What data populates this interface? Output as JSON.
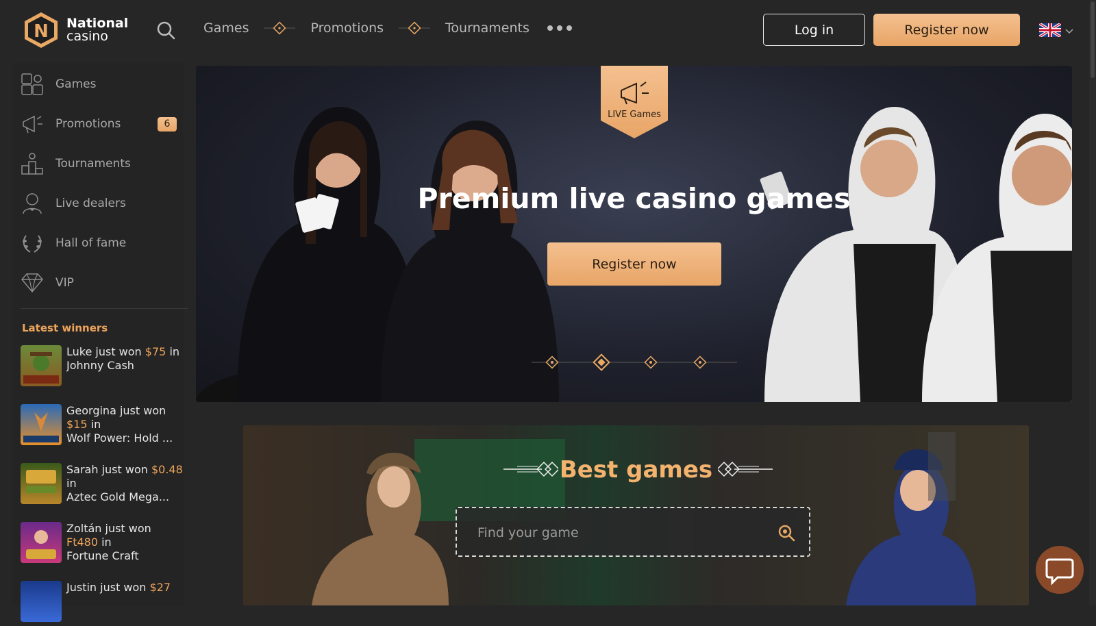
{
  "header": {
    "logo_line1": "National",
    "logo_line2": "casino",
    "logo_letter": "N",
    "nav": [
      "Games",
      "Promotions",
      "Tournaments"
    ],
    "login_label": "Log in",
    "register_label": "Register now",
    "language_icon": "uk-flag-icon"
  },
  "sidebar": {
    "items": [
      {
        "label": "Games",
        "icon": "puzzle-icon"
      },
      {
        "label": "Promotions",
        "icon": "megaphone-icon",
        "badge": "6"
      },
      {
        "label": "Tournaments",
        "icon": "podium-icon"
      },
      {
        "label": "Live dealers",
        "icon": "dealer-icon"
      },
      {
        "label": "Hall of fame",
        "icon": "laurel-icon"
      },
      {
        "label": "VIP",
        "icon": "diamond-icon"
      }
    ],
    "winners_title": "Latest winners",
    "winners": [
      {
        "name": "Luke just won",
        "amount": "$75",
        "in": "in",
        "game": "Johnny Cash"
      },
      {
        "name": "Georgina just won",
        "amount": "$15",
        "in": "in",
        "game": "Wolf Power: Hold ..."
      },
      {
        "name": "Sarah just won",
        "amount": "$0.48",
        "in": "in",
        "game": "Aztec Gold Mega..."
      },
      {
        "name": "Zoltán just won",
        "amount": "Ft480",
        "in": "in",
        "game": "Fortune Craft"
      },
      {
        "name": "Justin just won",
        "amount": "$27",
        "in": "",
        "game": ""
      }
    ]
  },
  "hero": {
    "tag_label": "LIVE Games",
    "title": "Premium live casino games",
    "cta_label": "Register now",
    "slides": 4,
    "active_slide": 2
  },
  "best_games": {
    "title": "Best games",
    "search_placeholder": "Find your game"
  },
  "colors": {
    "accent": "#eea55b",
    "button": "#eeb47c",
    "background": "#262626"
  }
}
